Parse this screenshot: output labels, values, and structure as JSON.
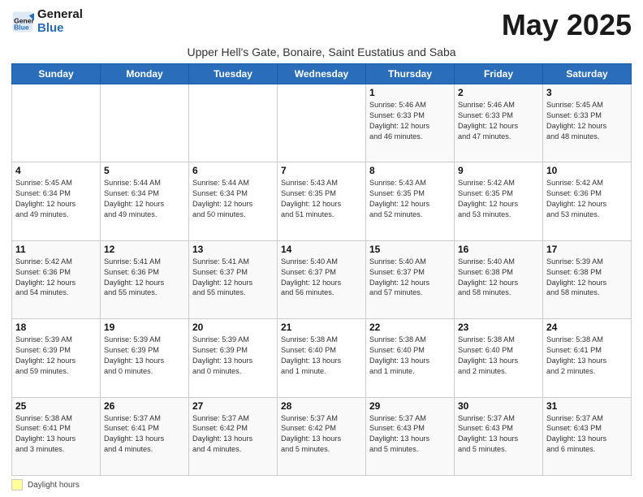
{
  "header": {
    "logo_line1": "General",
    "logo_line2": "Blue",
    "month_title": "May 2025",
    "subtitle": "Upper Hell's Gate, Bonaire, Saint Eustatius and Saba"
  },
  "weekdays": [
    "Sunday",
    "Monday",
    "Tuesday",
    "Wednesday",
    "Thursday",
    "Friday",
    "Saturday"
  ],
  "legend_label": "Daylight hours",
  "weeks": [
    [
      {
        "day": "",
        "info": ""
      },
      {
        "day": "",
        "info": ""
      },
      {
        "day": "",
        "info": ""
      },
      {
        "day": "",
        "info": ""
      },
      {
        "day": "1",
        "info": "Sunrise: 5:46 AM\nSunset: 6:33 PM\nDaylight: 12 hours\nand 46 minutes."
      },
      {
        "day": "2",
        "info": "Sunrise: 5:46 AM\nSunset: 6:33 PM\nDaylight: 12 hours\nand 47 minutes."
      },
      {
        "day": "3",
        "info": "Sunrise: 5:45 AM\nSunset: 6:33 PM\nDaylight: 12 hours\nand 48 minutes."
      }
    ],
    [
      {
        "day": "4",
        "info": "Sunrise: 5:45 AM\nSunset: 6:34 PM\nDaylight: 12 hours\nand 49 minutes."
      },
      {
        "day": "5",
        "info": "Sunrise: 5:44 AM\nSunset: 6:34 PM\nDaylight: 12 hours\nand 49 minutes."
      },
      {
        "day": "6",
        "info": "Sunrise: 5:44 AM\nSunset: 6:34 PM\nDaylight: 12 hours\nand 50 minutes."
      },
      {
        "day": "7",
        "info": "Sunrise: 5:43 AM\nSunset: 6:35 PM\nDaylight: 12 hours\nand 51 minutes."
      },
      {
        "day": "8",
        "info": "Sunrise: 5:43 AM\nSunset: 6:35 PM\nDaylight: 12 hours\nand 52 minutes."
      },
      {
        "day": "9",
        "info": "Sunrise: 5:42 AM\nSunset: 6:35 PM\nDaylight: 12 hours\nand 53 minutes."
      },
      {
        "day": "10",
        "info": "Sunrise: 5:42 AM\nSunset: 6:36 PM\nDaylight: 12 hours\nand 53 minutes."
      }
    ],
    [
      {
        "day": "11",
        "info": "Sunrise: 5:42 AM\nSunset: 6:36 PM\nDaylight: 12 hours\nand 54 minutes."
      },
      {
        "day": "12",
        "info": "Sunrise: 5:41 AM\nSunset: 6:36 PM\nDaylight: 12 hours\nand 55 minutes."
      },
      {
        "day": "13",
        "info": "Sunrise: 5:41 AM\nSunset: 6:37 PM\nDaylight: 12 hours\nand 55 minutes."
      },
      {
        "day": "14",
        "info": "Sunrise: 5:40 AM\nSunset: 6:37 PM\nDaylight: 12 hours\nand 56 minutes."
      },
      {
        "day": "15",
        "info": "Sunrise: 5:40 AM\nSunset: 6:37 PM\nDaylight: 12 hours\nand 57 minutes."
      },
      {
        "day": "16",
        "info": "Sunrise: 5:40 AM\nSunset: 6:38 PM\nDaylight: 12 hours\nand 58 minutes."
      },
      {
        "day": "17",
        "info": "Sunrise: 5:39 AM\nSunset: 6:38 PM\nDaylight: 12 hours\nand 58 minutes."
      }
    ],
    [
      {
        "day": "18",
        "info": "Sunrise: 5:39 AM\nSunset: 6:39 PM\nDaylight: 12 hours\nand 59 minutes."
      },
      {
        "day": "19",
        "info": "Sunrise: 5:39 AM\nSunset: 6:39 PM\nDaylight: 13 hours\nand 0 minutes."
      },
      {
        "day": "20",
        "info": "Sunrise: 5:39 AM\nSunset: 6:39 PM\nDaylight: 13 hours\nand 0 minutes."
      },
      {
        "day": "21",
        "info": "Sunrise: 5:38 AM\nSunset: 6:40 PM\nDaylight: 13 hours\nand 1 minute."
      },
      {
        "day": "22",
        "info": "Sunrise: 5:38 AM\nSunset: 6:40 PM\nDaylight: 13 hours\nand 1 minute."
      },
      {
        "day": "23",
        "info": "Sunrise: 5:38 AM\nSunset: 6:40 PM\nDaylight: 13 hours\nand 2 minutes."
      },
      {
        "day": "24",
        "info": "Sunrise: 5:38 AM\nSunset: 6:41 PM\nDaylight: 13 hours\nand 2 minutes."
      }
    ],
    [
      {
        "day": "25",
        "info": "Sunrise: 5:38 AM\nSunset: 6:41 PM\nDaylight: 13 hours\nand 3 minutes."
      },
      {
        "day": "26",
        "info": "Sunrise: 5:37 AM\nSunset: 6:41 PM\nDaylight: 13 hours\nand 4 minutes."
      },
      {
        "day": "27",
        "info": "Sunrise: 5:37 AM\nSunset: 6:42 PM\nDaylight: 13 hours\nand 4 minutes."
      },
      {
        "day": "28",
        "info": "Sunrise: 5:37 AM\nSunset: 6:42 PM\nDaylight: 13 hours\nand 5 minutes."
      },
      {
        "day": "29",
        "info": "Sunrise: 5:37 AM\nSunset: 6:43 PM\nDaylight: 13 hours\nand 5 minutes."
      },
      {
        "day": "30",
        "info": "Sunrise: 5:37 AM\nSunset: 6:43 PM\nDaylight: 13 hours\nand 5 minutes."
      },
      {
        "day": "31",
        "info": "Sunrise: 5:37 AM\nSunset: 6:43 PM\nDaylight: 13 hours\nand 6 minutes."
      }
    ]
  ]
}
